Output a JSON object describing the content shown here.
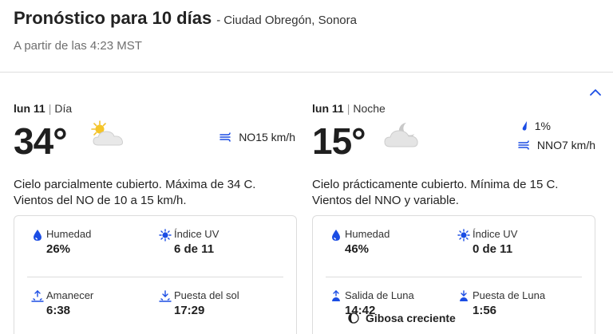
{
  "header": {
    "title": "Pronóstico para 10 días",
    "separator": "-",
    "location": "Ciudad Obregón, Sonora",
    "as_of": "A partir de las 4:23 MST"
  },
  "day": {
    "date": "lun 11",
    "period": "Día",
    "temp": "34°",
    "icon": "partly-cloudy-sun-icon",
    "wind": "NO15 km/h",
    "description": "Cielo parcialmente cubierto. Máxima de 34 C. Vientos del NO de 10 a 15 km/h.",
    "humidity_label": "Humedad",
    "humidity_value": "26%",
    "uv_label": "Índice UV",
    "uv_value": "6 de 11",
    "sunrise_label": "Amanecer",
    "sunrise_value": "6:38",
    "sunset_label": "Puesta del sol",
    "sunset_value": "17:29"
  },
  "night": {
    "date": "lun 11",
    "period": "Noche",
    "temp": "15°",
    "icon": "mostly-cloudy-night-icon",
    "precip": "1%",
    "wind": "NNO7 km/h",
    "description": "Cielo prácticamente cubierto. Mínima de 15 C. Vientos del NNO y variable.",
    "humidity_label": "Humedad",
    "humidity_value": "46%",
    "uv_label": "Índice UV",
    "uv_value": "0 de 11",
    "moonrise_label": "Salida de Luna",
    "moonrise_value": "14:42",
    "moonset_label": "Puesta de Luna",
    "moonset_value": "1:56",
    "moon_phase": "Gibosa creciente"
  },
  "colors": {
    "accent_blue": "#1b4de4",
    "text": "#1f1f1f",
    "muted": "#6f6f6f",
    "border": "#dcdcdc"
  }
}
